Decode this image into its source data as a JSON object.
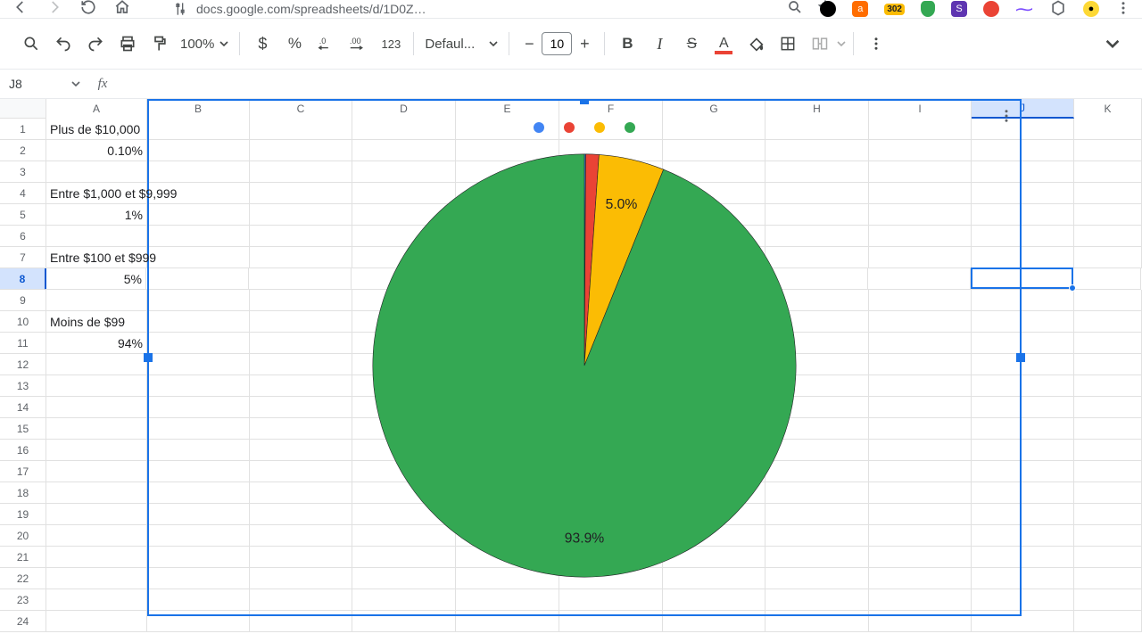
{
  "browser": {
    "url": "docs.google.com/spreadsheets/d/1D0ZhuPvQOZO5zB...",
    "ext_badge": "302"
  },
  "toolbar": {
    "zoom": "100%",
    "font_name": "Defaul...",
    "font_size": "10",
    "fmt_123": "123"
  },
  "name_box": "J8",
  "columns": [
    "A",
    "B",
    "C",
    "D",
    "E",
    "F",
    "G",
    "H",
    "I",
    "J",
    "K"
  ],
  "col_widths": [
    "wA",
    "wB",
    "wC",
    "wD",
    "wE",
    "wF",
    "wG",
    "wH",
    "wI",
    "wJ",
    "wK"
  ],
  "selected_col_idx": 9,
  "selected_row_idx": 7,
  "row_count": 24,
  "cells": {
    "A1": "Plus de $10,000",
    "A2_r": "0.10%",
    "A4": "Entre $1,000 et $9,999",
    "A5_r": "1%",
    "A7": "Entre $100 et $999",
    "A8_r": "5%",
    "A10": "Moins de $99",
    "A11_r": "94%"
  },
  "chart_data": {
    "type": "pie",
    "categories": [
      "Plus de $10,000",
      "Entre $1,000 et $9,999",
      "Entre $100 et $999",
      "Moins de $99"
    ],
    "values": [
      0.1,
      1.0,
      5.0,
      93.9
    ],
    "colors": [
      "#4285f4",
      "#ea4335",
      "#fbbc04",
      "#34a853"
    ],
    "visible_labels": {
      "2": "5.0%",
      "3": "93.9%"
    },
    "legend_position": "top"
  }
}
